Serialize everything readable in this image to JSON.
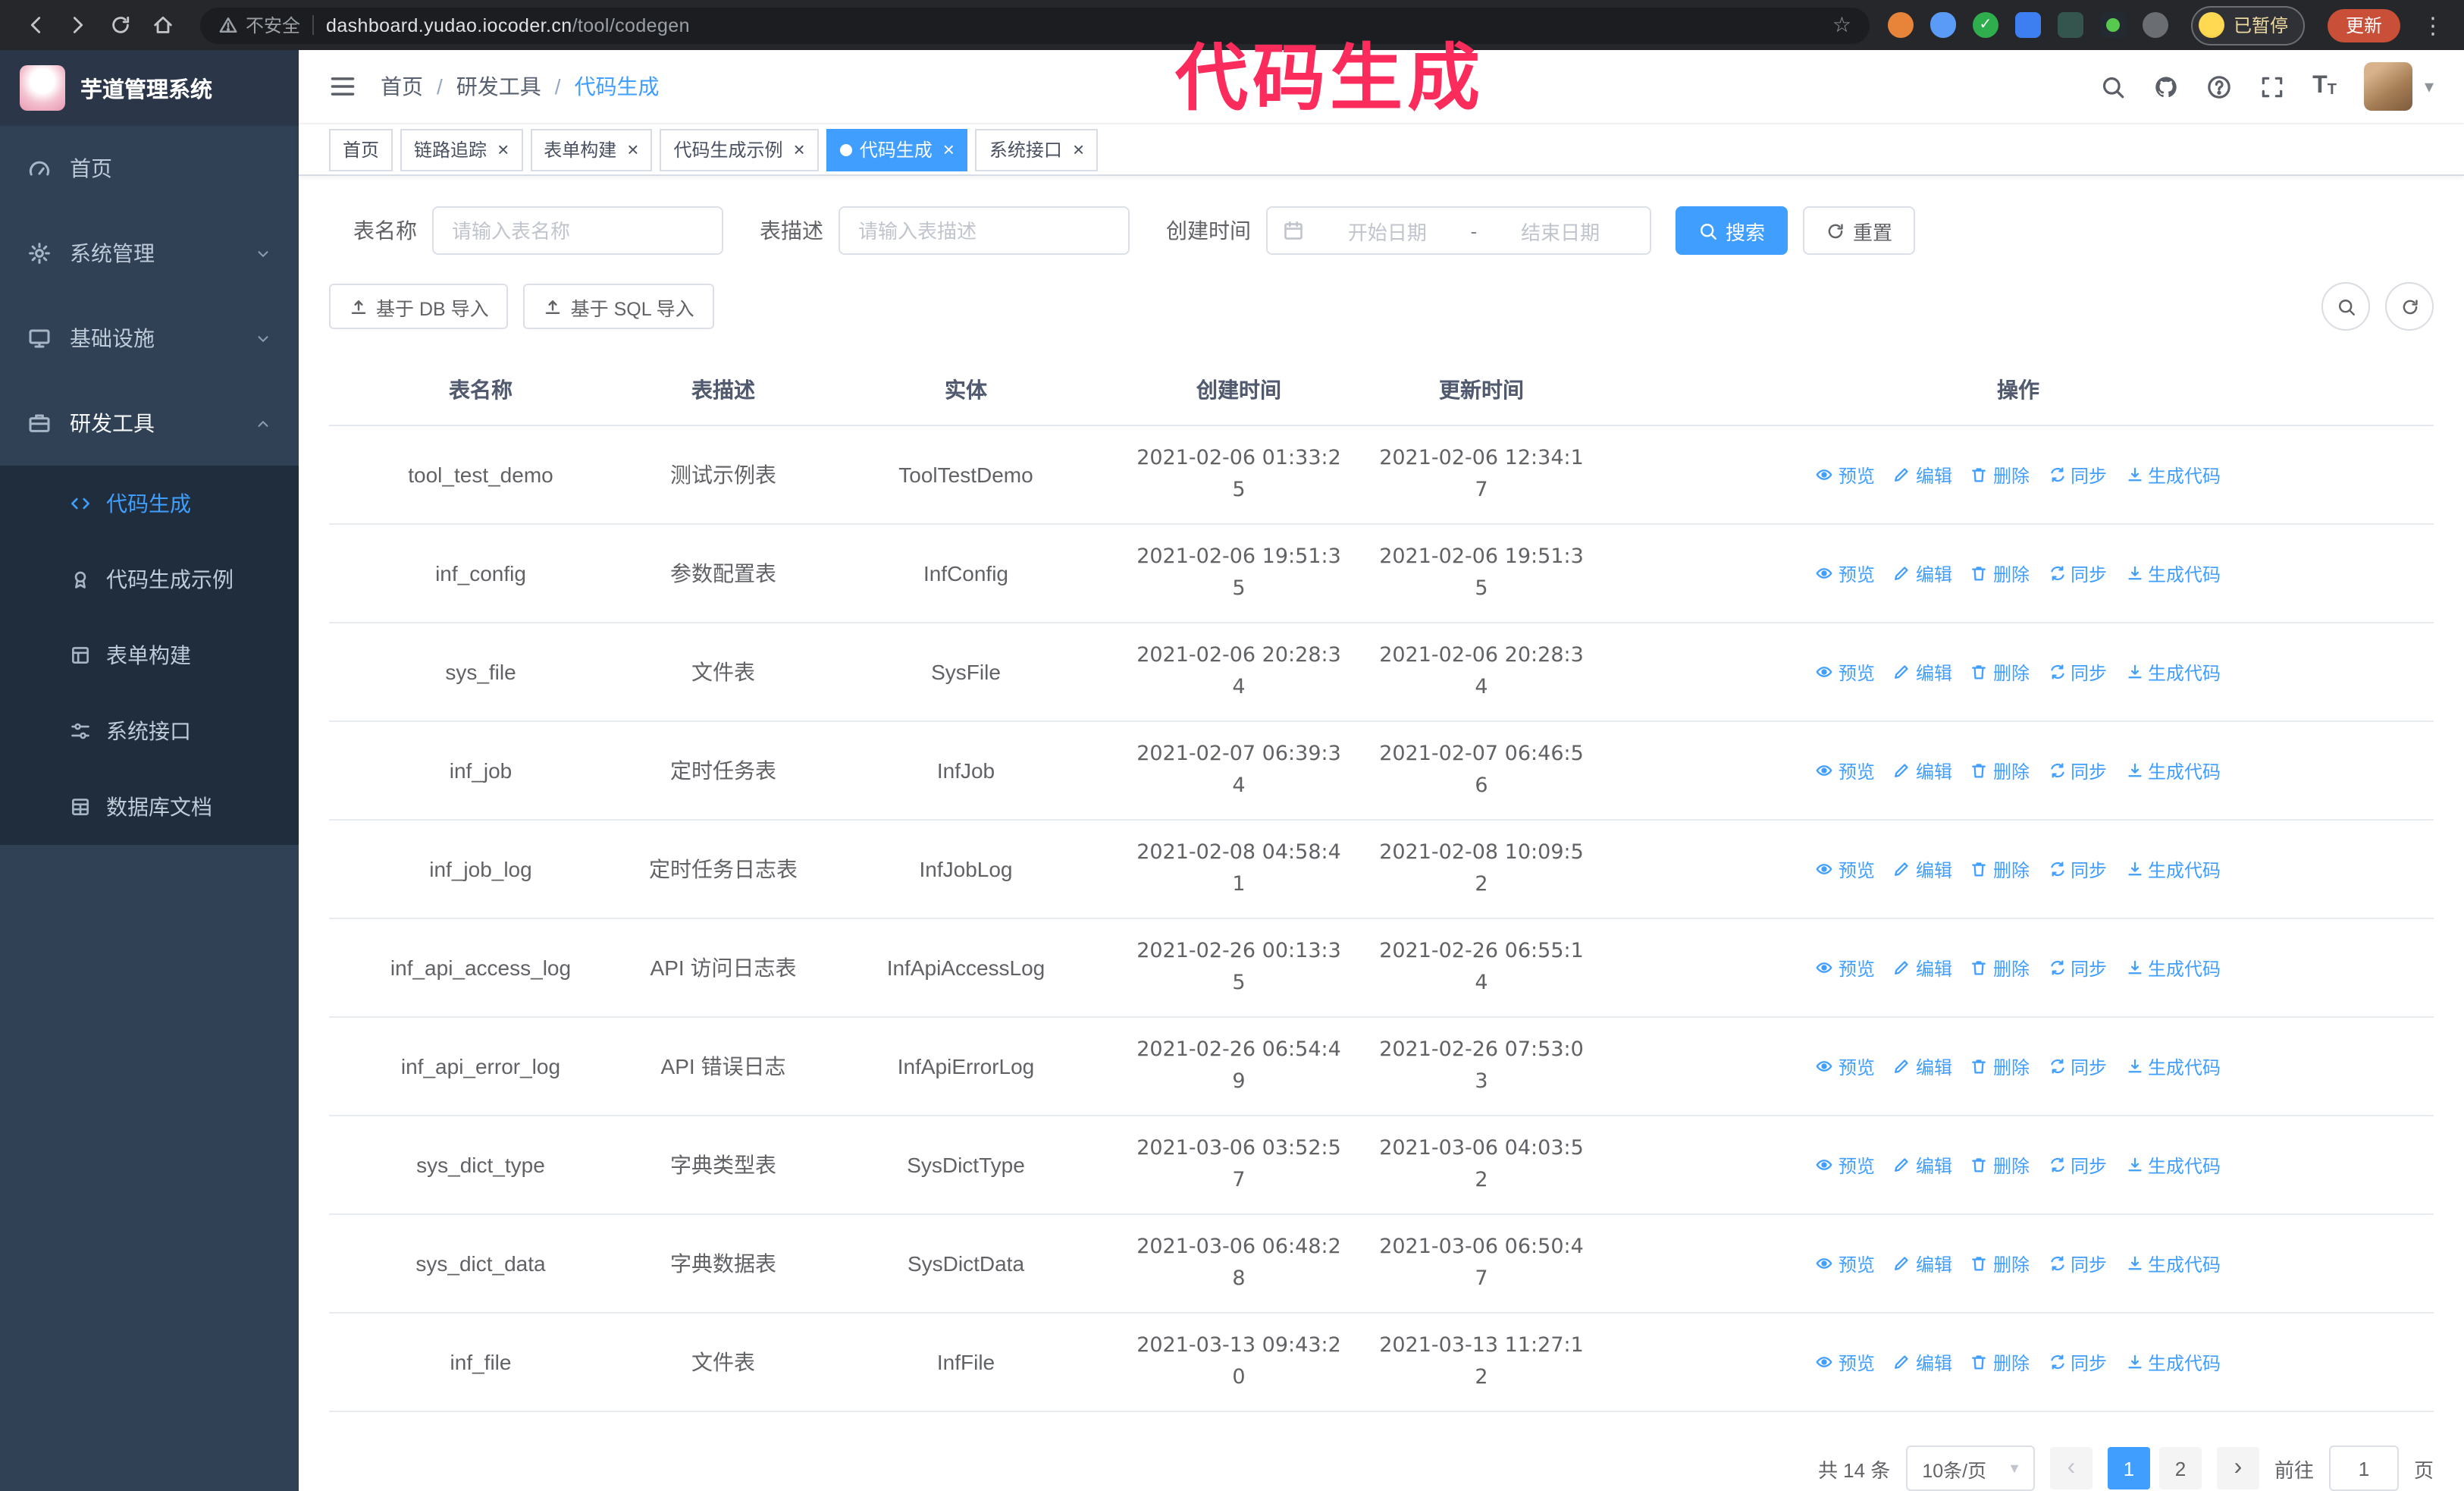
{
  "browser": {
    "security_label": "不安全",
    "url_host": "dashboard.yudao.iocoder.cn",
    "url_path": "/tool/codegen",
    "paused_badge": "已暂停",
    "update_button": "更新"
  },
  "annotation": {
    "text": "代码生成",
    "color": "#fb2b5c"
  },
  "sidebar": {
    "logo_title": "芋道管理系统",
    "items": [
      {
        "label": "首页",
        "icon": "dashboard-icon",
        "type": "item",
        "expanded": false
      },
      {
        "label": "系统管理",
        "icon": "gear-icon",
        "type": "group",
        "expanded": false
      },
      {
        "label": "基础设施",
        "icon": "infra-icon",
        "type": "group",
        "expanded": false
      },
      {
        "label": "研发工具",
        "icon": "tools-icon",
        "type": "group",
        "expanded": true
      }
    ],
    "submenu": [
      {
        "label": "代码生成",
        "icon": "code-icon",
        "active": true
      },
      {
        "label": "代码生成示例",
        "icon": "example-icon",
        "active": false
      },
      {
        "label": "表单构建",
        "icon": "form-icon",
        "active": false
      },
      {
        "label": "系统接口",
        "icon": "api-icon",
        "active": false
      },
      {
        "label": "数据库文档",
        "icon": "dbdoc-icon",
        "active": false
      }
    ]
  },
  "header": {
    "breadcrumb": [
      "首页",
      "研发工具",
      "代码生成"
    ]
  },
  "tabs": [
    {
      "label": "首页",
      "closable": false,
      "active": false
    },
    {
      "label": "链路追踪",
      "closable": true,
      "active": false
    },
    {
      "label": "表单构建",
      "closable": true,
      "active": false
    },
    {
      "label": "代码生成示例",
      "closable": true,
      "active": false
    },
    {
      "label": "代码生成",
      "closable": true,
      "active": true
    },
    {
      "label": "系统接口",
      "closable": true,
      "active": false
    }
  ],
  "filters": {
    "table_name_label": "表名称",
    "table_name_placeholder": "请输入表名称",
    "table_desc_label": "表描述",
    "table_desc_placeholder": "请输入表描述",
    "create_time_label": "创建时间",
    "date_start_placeholder": "开始日期",
    "date_separator": "-",
    "date_end_placeholder": "结束日期",
    "search_button": "搜索",
    "reset_button": "重置"
  },
  "toolbar": {
    "import_db_button": "基于 DB 导入",
    "import_sql_button": "基于 SQL 导入"
  },
  "table": {
    "columns": [
      "表名称",
      "表描述",
      "实体",
      "创建时间",
      "更新时间",
      "操作"
    ],
    "actions": [
      {
        "icon": "eye-icon",
        "label": "预览"
      },
      {
        "icon": "edit-icon",
        "label": "编辑"
      },
      {
        "icon": "delete-icon",
        "label": "删除"
      },
      {
        "icon": "sync-icon",
        "label": "同步"
      },
      {
        "icon": "generate-icon",
        "label": "生成代码"
      }
    ],
    "rows": [
      {
        "name": "tool_test_demo",
        "desc": "测试示例表",
        "entity": "ToolTestDemo",
        "created": "2021-02-06 01:33:25",
        "updated": "2021-02-06 12:34:17"
      },
      {
        "name": "inf_config",
        "desc": "参数配置表",
        "entity": "InfConfig",
        "created": "2021-02-06 19:51:35",
        "updated": "2021-02-06 19:51:35"
      },
      {
        "name": "sys_file",
        "desc": "文件表",
        "entity": "SysFile",
        "created": "2021-02-06 20:28:34",
        "updated": "2021-02-06 20:28:34"
      },
      {
        "name": "inf_job",
        "desc": "定时任务表",
        "entity": "InfJob",
        "created": "2021-02-07 06:39:34",
        "updated": "2021-02-07 06:46:56"
      },
      {
        "name": "inf_job_log",
        "desc": "定时任务日志表",
        "entity": "InfJobLog",
        "created": "2021-02-08 04:58:41",
        "updated": "2021-02-08 10:09:52"
      },
      {
        "name": "inf_api_access_log",
        "desc": "API 访问日志表",
        "entity": "InfApiAccessLog",
        "created": "2021-02-26 00:13:35",
        "updated": "2021-02-26 06:55:14"
      },
      {
        "name": "inf_api_error_log",
        "desc": "API 错误日志",
        "entity": "InfApiErrorLog",
        "created": "2021-02-26 06:54:49",
        "updated": "2021-02-26 07:53:03"
      },
      {
        "name": "sys_dict_type",
        "desc": "字典类型表",
        "entity": "SysDictType",
        "created": "2021-03-06 03:52:57",
        "updated": "2021-03-06 04:03:52"
      },
      {
        "name": "sys_dict_data",
        "desc": "字典数据表",
        "entity": "SysDictData",
        "created": "2021-03-06 06:48:28",
        "updated": "2021-03-06 06:50:47"
      },
      {
        "name": "inf_file",
        "desc": "文件表",
        "entity": "InfFile",
        "created": "2021-03-13 09:43:20",
        "updated": "2021-03-13 11:27:12"
      }
    ]
  },
  "pagination": {
    "total_text": "共 14 条",
    "page_size": "10条/页",
    "pages": [
      "1",
      "2"
    ],
    "active_page": "1",
    "goto_label": "前往",
    "goto_value": "1",
    "goto_suffix": "页"
  },
  "colors": {
    "accent": "#409eff",
    "annotation": "#fb2b5c",
    "sidebar_bg": "#304156"
  }
}
